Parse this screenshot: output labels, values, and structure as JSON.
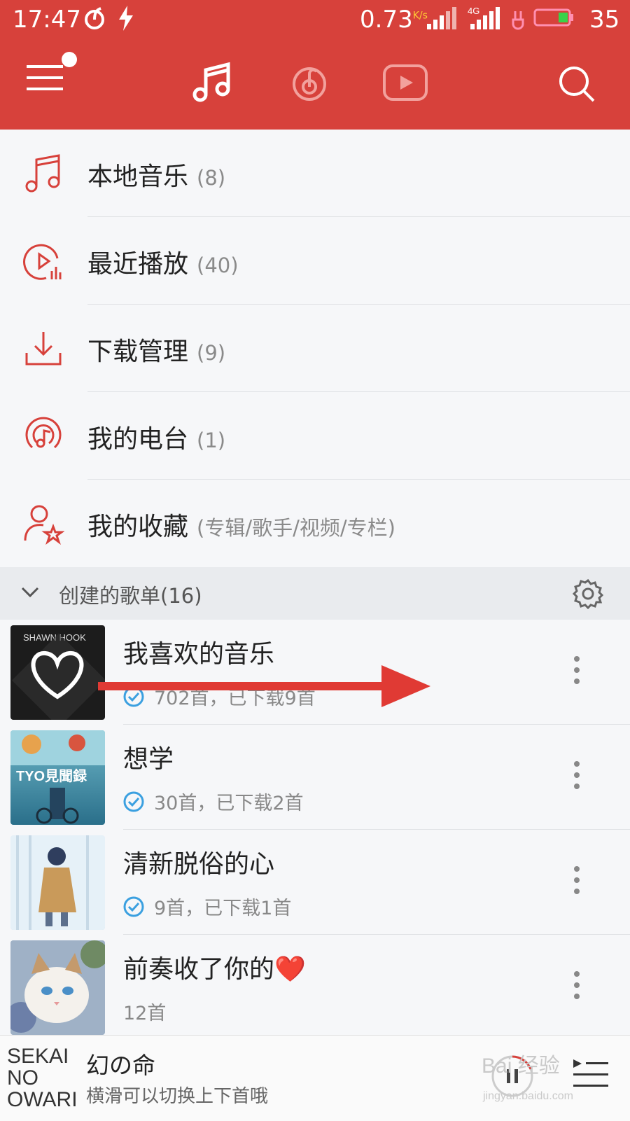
{
  "status_bar": {
    "time": "17:47",
    "net_speed": "0.73",
    "net_unit": "K/s",
    "network": "4G",
    "battery": "35"
  },
  "nav": {
    "icons": [
      "menu-icon",
      "music-note-icon",
      "netease-cloud-icon",
      "video-play-icon",
      "search-icon"
    ]
  },
  "menu_items": [
    {
      "label": "本地音乐",
      "count": "(8)",
      "icon": "music-note-icon"
    },
    {
      "label": "最近播放",
      "count": "(40)",
      "icon": "recent-play-icon"
    },
    {
      "label": "下载管理",
      "count": "(9)",
      "icon": "download-icon"
    },
    {
      "label": "我的电台",
      "count": "(1)",
      "icon": "radio-icon"
    },
    {
      "label": "我的收藏",
      "count": "(专辑/歌手/视频/专栏)",
      "icon": "favorite-user-icon"
    }
  ],
  "section": {
    "title": "创建的歌单(16)"
  },
  "playlists": [
    {
      "name": "我喜欢的音乐",
      "sub": "702首，已下载9首",
      "downloaded": true,
      "cover_text": "SHAWN HOOK"
    },
    {
      "name": "想学",
      "sub": "30首，已下载2首",
      "downloaded": true,
      "cover_text": "TYO見聞録"
    },
    {
      "name": "清新脱俗的心",
      "sub": "9首，已下载1首",
      "downloaded": true,
      "cover_text": ""
    },
    {
      "name": "前奏收了你的❤️",
      "sub": "12首",
      "downloaded": false,
      "cover_text": ""
    }
  ],
  "player": {
    "art_text": "SEKAI NO OWARI",
    "song": "幻の命",
    "hint": "横滑可以切换上下首哦"
  },
  "watermark": {
    "text": "Bai 经验",
    "url": "jingyan.baidu.com"
  },
  "colors": {
    "brand": "#d7413b",
    "check": "#3ba0e0",
    "arrow": "#e03a34"
  }
}
